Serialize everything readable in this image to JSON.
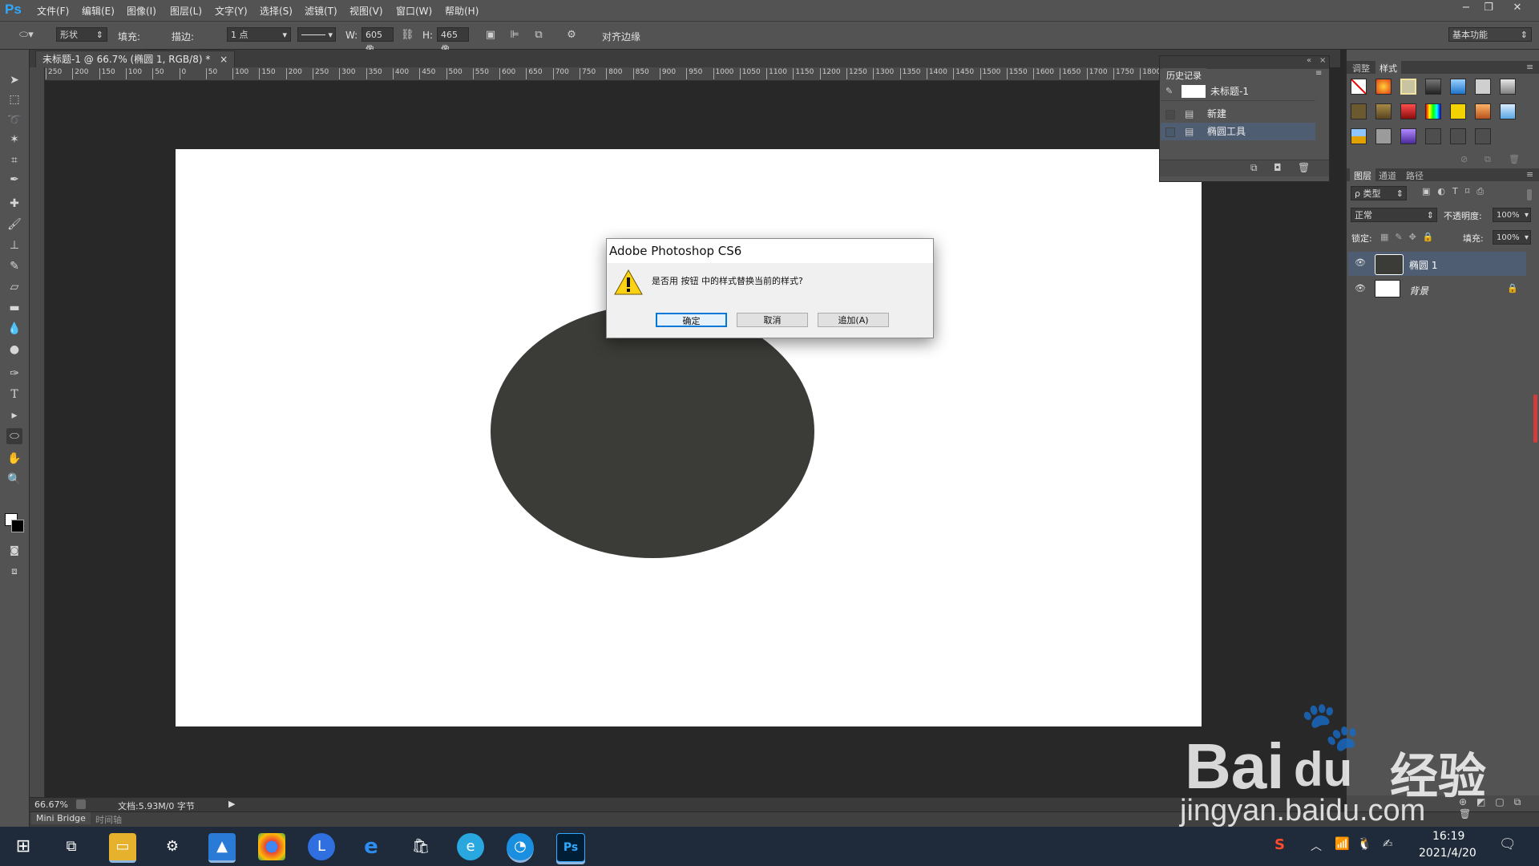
{
  "menubar": {
    "logo": "Ps",
    "items": [
      "文件(F)",
      "编辑(E)",
      "图像(I)",
      "图层(L)",
      "文字(Y)",
      "选择(S)",
      "滤镜(T)",
      "视图(V)",
      "窗口(W)",
      "帮助(H)"
    ]
  },
  "options": {
    "mode": "形状",
    "fill_label": "填充:",
    "stroke_label": "描边:",
    "stroke_width": "1 点",
    "w_label": "W:",
    "w_value": "605 像",
    "h_label": "H:",
    "h_value": "465 像",
    "align_edges": "对齐边缘",
    "workspace": "基本功能"
  },
  "document": {
    "tab_title": "未标题-1 @ 66.7% (椭圆 1, RGB/8) *",
    "tab_close": "×",
    "ruler_ticks": [
      "250",
      "200",
      "150",
      "100",
      "50",
      "0",
      "50",
      "100",
      "150",
      "200",
      "250",
      "300",
      "350",
      "400",
      "450",
      "500",
      "550",
      "600",
      "650",
      "700",
      "750",
      "800",
      "850",
      "900",
      "950",
      "1000",
      "1050",
      "1100",
      "1150",
      "1200",
      "1250",
      "1300",
      "1350",
      "1400",
      "1450",
      "1500",
      "1550",
      "1600",
      "1650",
      "1700",
      "1750",
      "1800"
    ],
    "zoom": "66.67%",
    "doc_info": "文档:5.93M/0 字节"
  },
  "bottom_tabs": [
    "Mini Bridge",
    "时间轴"
  ],
  "dialog": {
    "title": "Adobe Photoshop CS6",
    "message": "是否用 按钮 中的样式替换当前的样式?",
    "ok": "确定",
    "cancel": "取消",
    "append": "追加(A)"
  },
  "history": {
    "title": "历史记录",
    "snapshot": "未标题-1",
    "steps": [
      "新建",
      "椭圆工具"
    ]
  },
  "right_panels": {
    "tabs_top": [
      "调整",
      "样式"
    ],
    "tabs_layers": [
      "图层",
      "通道",
      "路径"
    ],
    "filter_kind": "ρ 类型",
    "blend_mode": "正常",
    "opacity_label": "不透明度:",
    "opacity": "100%",
    "lock_label": "锁定:",
    "fill_label": "填充:",
    "fill": "100%",
    "layers": [
      {
        "name": "椭圆 1",
        "selected": true
      },
      {
        "name": "背景",
        "selected": false
      }
    ]
  },
  "taskbar": {
    "time": "16:19",
    "date": "2021/4/20"
  },
  "watermark": {
    "brand": "Bai",
    "brand2": "du",
    "cn": "经验",
    "url": "jingyan.baidu.com"
  },
  "colors": {
    "accent_ps": "#31a8ff",
    "panel_bg": "#535353",
    "canvas_bg": "#282828",
    "ellipse_fill": "#3b3c38",
    "dialog_ok_border": "#0078d7"
  }
}
